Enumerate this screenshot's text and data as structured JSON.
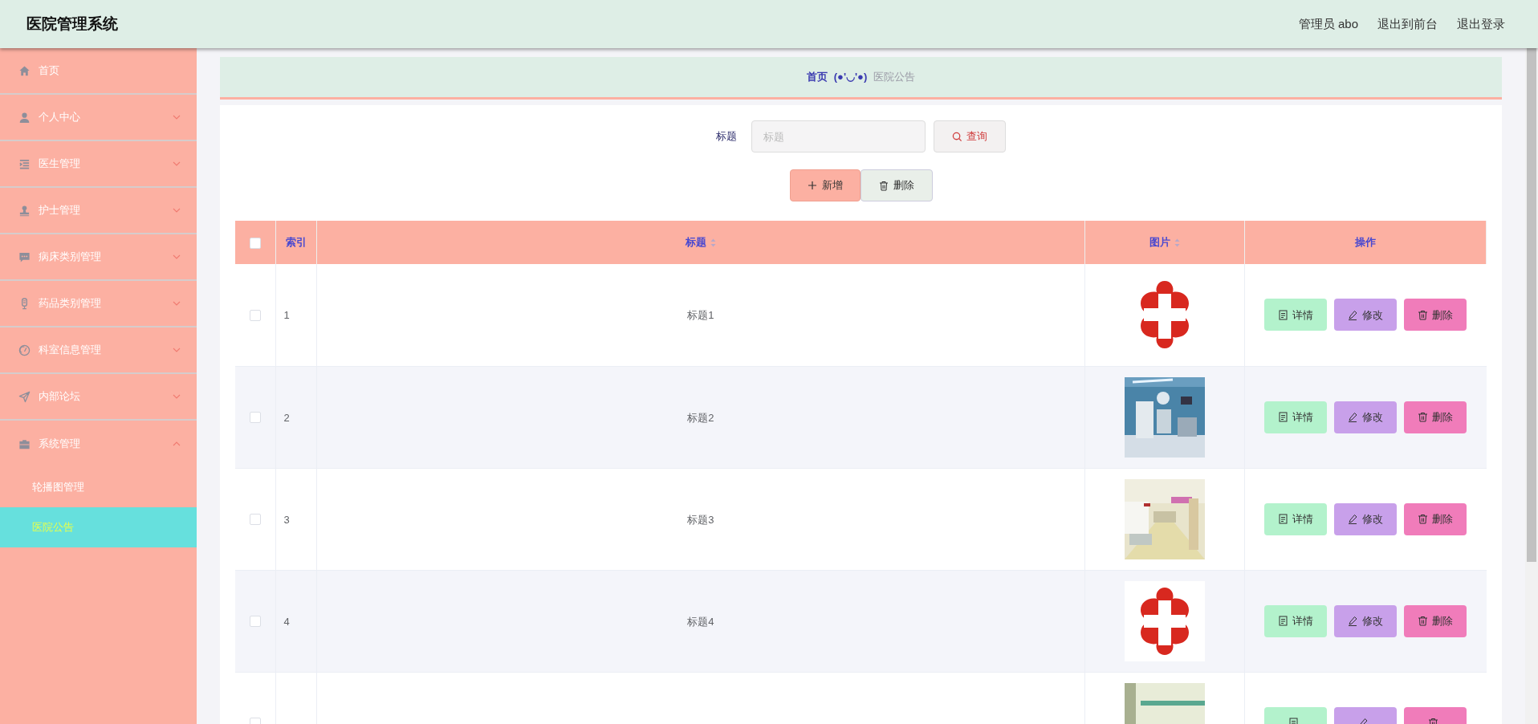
{
  "header": {
    "title": "医院管理系统",
    "links": [
      "管理员 abo",
      "退出到前台",
      "退出登录"
    ]
  },
  "sidebar": {
    "items": [
      {
        "label": "首页",
        "kind": "link",
        "selected": false
      },
      {
        "label": "个人中心",
        "kind": "menu",
        "expanded": false,
        "selected": false
      },
      {
        "label": "医生管理",
        "kind": "menu",
        "expanded": false,
        "selected": false
      },
      {
        "label": "护士管理",
        "kind": "menu",
        "expanded": false,
        "selected": false
      },
      {
        "label": "病床类别管理",
        "kind": "menu",
        "expanded": false,
        "selected": false
      },
      {
        "label": "药品类别管理",
        "kind": "menu",
        "expanded": false,
        "selected": false
      },
      {
        "label": "科室信息管理",
        "kind": "menu",
        "expanded": false,
        "selected": false
      },
      {
        "label": "内部论坛",
        "kind": "menu",
        "expanded": false,
        "selected": false
      },
      {
        "label": "系统管理",
        "kind": "menu",
        "expanded": true,
        "selected": false,
        "children": [
          {
            "label": "轮播图管理",
            "selected": false
          },
          {
            "label": "医院公告",
            "selected": true
          }
        ]
      }
    ]
  },
  "breadcrumb": {
    "home": "首页",
    "separator": "(●'◡'●)",
    "current": "医院公告"
  },
  "search": {
    "label": "标题",
    "placeholder": "标题",
    "button": "查询"
  },
  "actions": {
    "add": "新增",
    "delete": "删除"
  },
  "table": {
    "header_checked": false,
    "columns": [
      {
        "label": "索引",
        "sortable": false
      },
      {
        "label": "标题",
        "sortable": true
      },
      {
        "label": "图片",
        "sortable": true
      },
      {
        "label": "操作",
        "sortable": false
      }
    ],
    "rows": [
      {
        "checked": false,
        "index": "1",
        "title": "标题1",
        "actions": [
          "详情",
          "修改",
          "删除"
        ]
      },
      {
        "checked": false,
        "index": "2",
        "title": "标题2",
        "actions": [
          "详情",
          "修改",
          "删除"
        ]
      },
      {
        "checked": false,
        "index": "3",
        "title": "标题3",
        "actions": [
          "详情",
          "修改",
          "删除"
        ]
      },
      {
        "checked": false,
        "index": "4",
        "title": "标题4",
        "actions": [
          "详情",
          "修改",
          "删除"
        ]
      },
      {
        "checked": false
      }
    ]
  }
}
